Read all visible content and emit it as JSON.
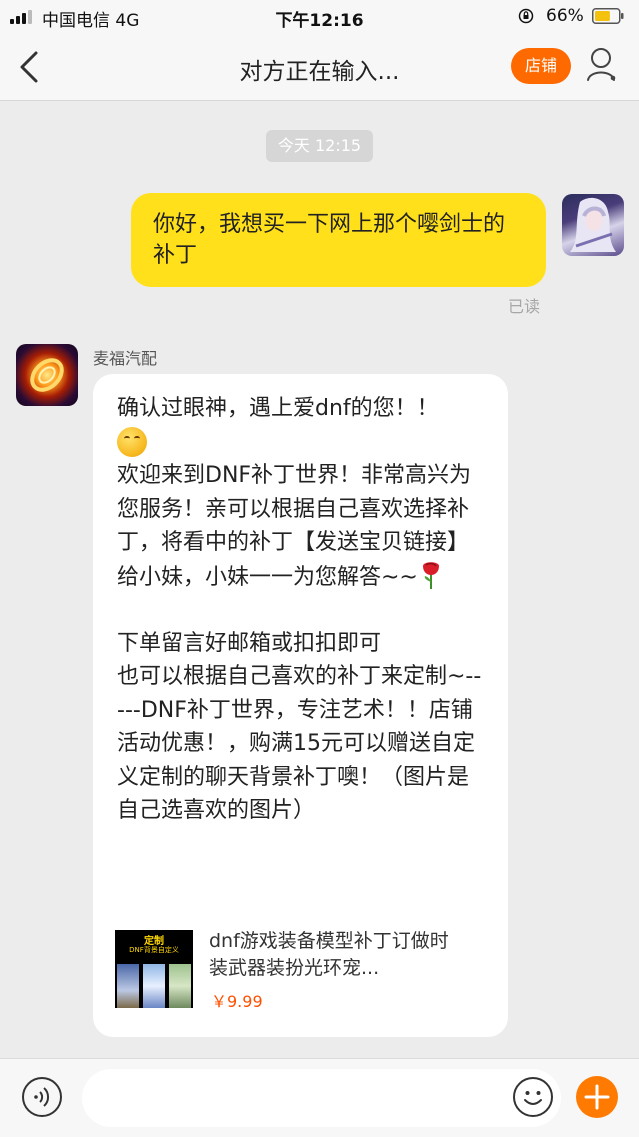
{
  "status_bar": {
    "carrier": "中国电信   4G",
    "time": "下午12:16",
    "battery_percent": "66%",
    "battery_level": 0.66
  },
  "nav": {
    "title": "对方正在输入...",
    "shop_label": "店铺"
  },
  "chat": {
    "timestamp": "今天 12:15",
    "outgoing_message": "你好，我想买一下网上那个嘤剑士的补丁",
    "read_status": "已读",
    "sender_name": "麦福汽配",
    "incoming": {
      "line1": "确认过眼神，遇上爱dnf的您！！",
      "para1": "欢迎来到DNF补丁世界！非常高兴为您服务！亲可以根据自己喜欢选择补丁，将看中的补丁【发送宝贝链接】给小妹，小妹一一为您解答~~",
      "para2_line1": "下单留言好邮箱或扣扣即可",
      "para2_rest": "也可以根据自己喜欢的补丁来定制~-----DNF补丁世界，专注艺术！！店铺活动优惠！，购满15元可以赠送自定义定制的聊天背景补丁噢！（图片是自己选喜欢的图片）"
    },
    "product": {
      "thumb_title": "定制",
      "thumb_subtitle": "DNF背景自定义",
      "name": "dnf游戏装备模型补丁订做时装武器装扮光环宠...",
      "price": "￥9.99"
    }
  },
  "input_bar": {
    "placeholder": ""
  },
  "colors": {
    "accent_orange": "#ff6a00",
    "bubble_out": "#ffe01a",
    "price_red": "#ff5000"
  }
}
